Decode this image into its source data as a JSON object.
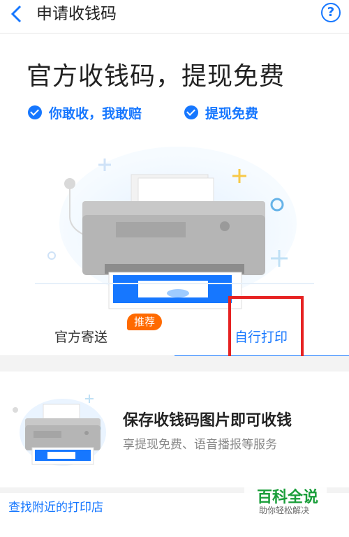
{
  "header": {
    "title": "申请收钱码",
    "help_glyph": "?"
  },
  "hero": {
    "title": "官方收钱码，提现免费",
    "features": [
      {
        "label": "你敢收，我敢赔",
        "icon": "check-circle-icon"
      },
      {
        "label": "提现免费",
        "icon": "check-circle-icon"
      }
    ]
  },
  "tabs": {
    "official_label": "官方寄送",
    "recommend_badge": "推荐",
    "self_label": "自行打印"
  },
  "card": {
    "title": "保存收钱码图片即可收钱",
    "subtitle": "享提现免费、语音播报等服务"
  },
  "footer": {
    "link": "查找附近的打印店"
  },
  "watermark": {
    "title": "百科全说",
    "subtitle": "助你轻松解决"
  },
  "colors": {
    "accent": "#1677ff",
    "badge": "#ff6a00",
    "highlight": "#e62222",
    "watermark": "#1a9e3a"
  }
}
